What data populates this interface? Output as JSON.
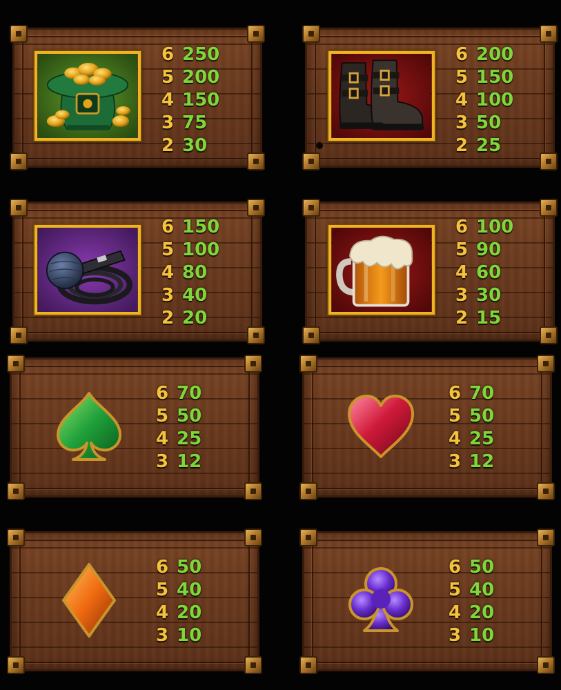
{
  "colors": {
    "background": "#030303",
    "wood": "#6a3a1e",
    "frame_gold": "#f0b323",
    "count_color": "#f5c23b",
    "value_color": "#7fd63a"
  },
  "paytable": [
    {
      "symbol": "pot-of-gold-hat",
      "icon": "leprechaun-hat-with-gold-coins-icon",
      "pays": [
        {
          "count": "6",
          "value": "250"
        },
        {
          "count": "5",
          "value": "200"
        },
        {
          "count": "4",
          "value": "150"
        },
        {
          "count": "3",
          "value": "75"
        },
        {
          "count": "2",
          "value": "30"
        }
      ]
    },
    {
      "symbol": "boots",
      "icon": "buckled-boots-icon",
      "pays": [
        {
          "count": "6",
          "value": "200"
        },
        {
          "count": "5",
          "value": "150"
        },
        {
          "count": "4",
          "value": "100"
        },
        {
          "count": "3",
          "value": "50"
        },
        {
          "count": "2",
          "value": "25"
        }
      ]
    },
    {
      "symbol": "microphone",
      "icon": "microphone-icon",
      "pays": [
        {
          "count": "6",
          "value": "150"
        },
        {
          "count": "5",
          "value": "100"
        },
        {
          "count": "4",
          "value": "80"
        },
        {
          "count": "3",
          "value": "40"
        },
        {
          "count": "2",
          "value": "20"
        }
      ]
    },
    {
      "symbol": "beer-mug",
      "icon": "beer-mug-icon",
      "pays": [
        {
          "count": "6",
          "value": "100"
        },
        {
          "count": "5",
          "value": "90"
        },
        {
          "count": "4",
          "value": "60"
        },
        {
          "count": "3",
          "value": "30"
        },
        {
          "count": "2",
          "value": "15"
        }
      ]
    },
    {
      "symbol": "spade",
      "icon": "green-spade-icon",
      "pays": [
        {
          "count": "6",
          "value": "70"
        },
        {
          "count": "5",
          "value": "50"
        },
        {
          "count": "4",
          "value": "25"
        },
        {
          "count": "3",
          "value": "12"
        }
      ]
    },
    {
      "symbol": "heart",
      "icon": "red-heart-icon",
      "pays": [
        {
          "count": "6",
          "value": "70"
        },
        {
          "count": "5",
          "value": "50"
        },
        {
          "count": "4",
          "value": "25"
        },
        {
          "count": "3",
          "value": "12"
        }
      ]
    },
    {
      "symbol": "diamond",
      "icon": "orange-diamond-icon",
      "pays": [
        {
          "count": "6",
          "value": "50"
        },
        {
          "count": "5",
          "value": "40"
        },
        {
          "count": "4",
          "value": "20"
        },
        {
          "count": "3",
          "value": "10"
        }
      ]
    },
    {
      "symbol": "club",
      "icon": "purple-club-icon",
      "pays": [
        {
          "count": "6",
          "value": "50"
        },
        {
          "count": "5",
          "value": "40"
        },
        {
          "count": "4",
          "value": "20"
        },
        {
          "count": "3",
          "value": "10"
        }
      ]
    }
  ]
}
